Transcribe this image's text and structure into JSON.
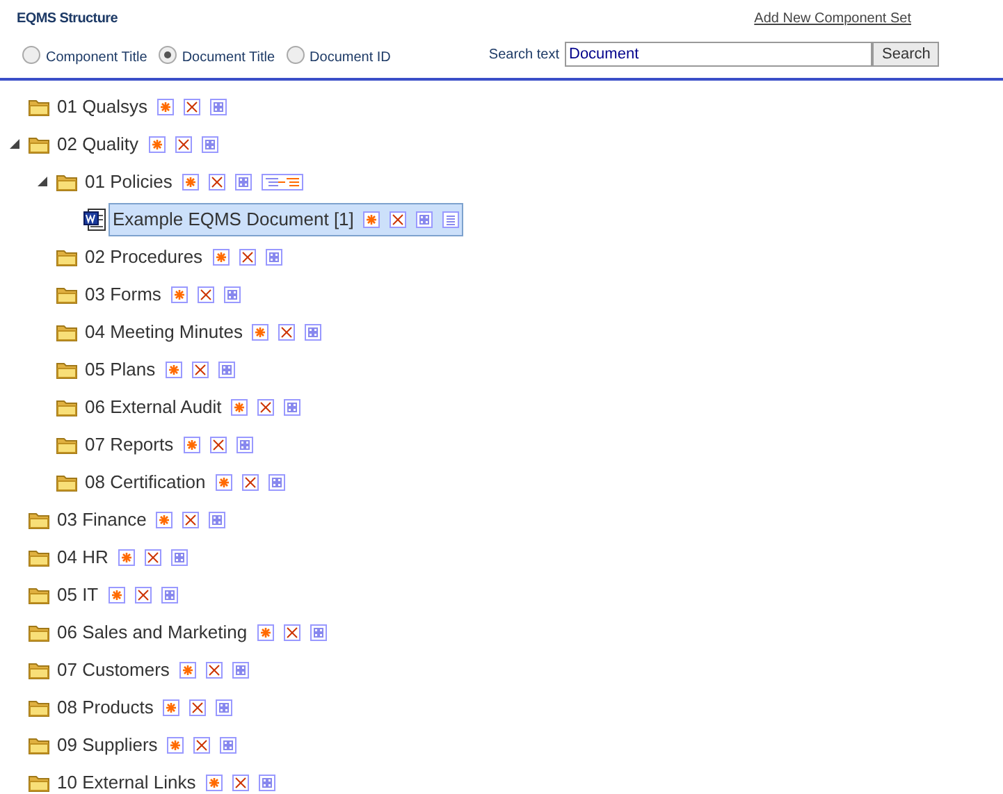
{
  "header": {
    "title": "EQMS Structure",
    "add_link": "Add New Component Set"
  },
  "search_modes": [
    {
      "label": "Component Title",
      "selected": false
    },
    {
      "label": "Document Title",
      "selected": true
    },
    {
      "label": "Document ID",
      "selected": false
    }
  ],
  "search": {
    "label": "Search text",
    "value": "Document",
    "button": "Search"
  },
  "tree": [
    {
      "kind": "folder",
      "label": "01 Qualsys",
      "selected": false,
      "actions": [
        {
          "kind": "add"
        },
        {
          "kind": "delete"
        },
        {
          "kind": "grid"
        }
      ]
    },
    {
      "kind": "folder",
      "label": "02 Quality",
      "selected": false,
      "expanded": true,
      "actions": [
        {
          "kind": "add"
        },
        {
          "kind": "delete"
        },
        {
          "kind": "grid"
        }
      ],
      "children": [
        {
          "kind": "folder",
          "label": "01 Policies",
          "selected": false,
          "expanded": true,
          "actions": [
            {
              "kind": "add"
            },
            {
              "kind": "delete"
            },
            {
              "kind": "grid"
            },
            {
              "kind": "reorder"
            }
          ],
          "children": [
            {
              "kind": "document",
              "label": "Example EQMS Document [1]",
              "selected": true,
              "actions": [
                {
                  "kind": "add"
                },
                {
                  "kind": "delete"
                },
                {
                  "kind": "grid"
                },
                {
                  "kind": "list"
                }
              ]
            }
          ]
        },
        {
          "kind": "folder",
          "label": "02 Procedures",
          "selected": false,
          "actions": [
            {
              "kind": "add"
            },
            {
              "kind": "delete"
            },
            {
              "kind": "grid"
            }
          ]
        },
        {
          "kind": "folder",
          "label": "03 Forms",
          "selected": false,
          "actions": [
            {
              "kind": "add"
            },
            {
              "kind": "delete"
            },
            {
              "kind": "grid"
            }
          ]
        },
        {
          "kind": "folder",
          "label": "04 Meeting Minutes",
          "selected": false,
          "actions": [
            {
              "kind": "add"
            },
            {
              "kind": "delete"
            },
            {
              "kind": "grid"
            }
          ]
        },
        {
          "kind": "folder",
          "label": "05 Plans",
          "selected": false,
          "actions": [
            {
              "kind": "add"
            },
            {
              "kind": "delete"
            },
            {
              "kind": "grid"
            }
          ]
        },
        {
          "kind": "folder",
          "label": "06 External Audit",
          "selected": false,
          "actions": [
            {
              "kind": "add"
            },
            {
              "kind": "delete"
            },
            {
              "kind": "grid"
            }
          ]
        },
        {
          "kind": "folder",
          "label": "07 Reports",
          "selected": false,
          "actions": [
            {
              "kind": "add"
            },
            {
              "kind": "delete"
            },
            {
              "kind": "grid"
            }
          ]
        },
        {
          "kind": "folder",
          "label": "08 Certification",
          "selected": false,
          "actions": [
            {
              "kind": "add"
            },
            {
              "kind": "delete"
            },
            {
              "kind": "grid"
            }
          ]
        }
      ]
    },
    {
      "kind": "folder",
      "label": "03 Finance",
      "selected": false,
      "actions": [
        {
          "kind": "add"
        },
        {
          "kind": "delete"
        },
        {
          "kind": "grid"
        }
      ]
    },
    {
      "kind": "folder",
      "label": "04 HR",
      "selected": false,
      "actions": [
        {
          "kind": "add"
        },
        {
          "kind": "delete"
        },
        {
          "kind": "grid"
        }
      ]
    },
    {
      "kind": "folder",
      "label": "05 IT",
      "selected": false,
      "actions": [
        {
          "kind": "add"
        },
        {
          "kind": "delete"
        },
        {
          "kind": "grid"
        }
      ]
    },
    {
      "kind": "folder",
      "label": "06 Sales and Marketing",
      "selected": false,
      "actions": [
        {
          "kind": "add"
        },
        {
          "kind": "delete"
        },
        {
          "kind": "grid"
        }
      ]
    },
    {
      "kind": "folder",
      "label": "07 Customers",
      "selected": false,
      "actions": [
        {
          "kind": "add"
        },
        {
          "kind": "delete"
        },
        {
          "kind": "grid"
        }
      ]
    },
    {
      "kind": "folder",
      "label": "08 Products",
      "selected": false,
      "actions": [
        {
          "kind": "add"
        },
        {
          "kind": "delete"
        },
        {
          "kind": "grid"
        }
      ]
    },
    {
      "kind": "folder",
      "label": "09 Suppliers",
      "selected": false,
      "actions": [
        {
          "kind": "add"
        },
        {
          "kind": "delete"
        },
        {
          "kind": "grid"
        }
      ]
    },
    {
      "kind": "folder",
      "label": "10 External Links",
      "selected": false,
      "actions": [
        {
          "kind": "add"
        },
        {
          "kind": "delete"
        },
        {
          "kind": "grid"
        }
      ]
    }
  ]
}
